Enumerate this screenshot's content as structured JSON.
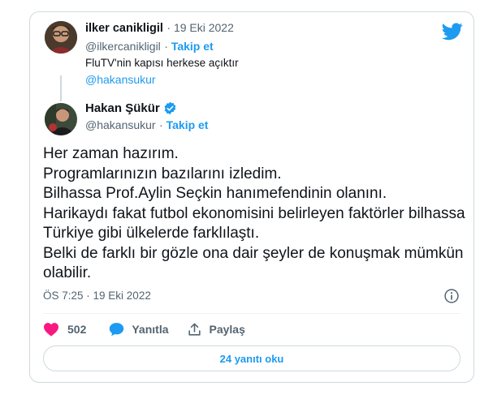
{
  "quoted": {
    "display_name": "ilker canikligil",
    "date": "19 Eki 2022",
    "handle": "@ilkercanikligil",
    "follow_label": "Takip et",
    "text": "FluTV'nin kapısı herkese açıktır",
    "mention": "@hakansukur"
  },
  "main": {
    "display_name": "Hakan Şükür",
    "handle": "@hakansukur",
    "follow_label": "Takip et",
    "body": "Her zaman hazırım.\nProgramlarınızın bazılarını izledim.\nBilhassa Prof.Aylin Seçkin hanımefendinin olanını.\nHarikaydı fakat futbol ekonomisini belirleyen faktörler bilhassa Türkiye gibi ülkelerde farklılaştı.\nBelki de farklı bir gözle ona dair şeyler de konuşmak mümkün olabilir.",
    "timestamp": "ÖS 7:25 · 19 Eki 2022"
  },
  "actions": {
    "likes": "502",
    "reply_label": "Yanıtla",
    "share_label": "Paylaş"
  },
  "footer": {
    "read_replies_label": "24 yanıtı oku"
  },
  "icons": {
    "brand": "twitter-bird-icon",
    "verified": "verified-badge-icon",
    "info": "info-icon",
    "like": "heart-icon",
    "reply": "speech-bubble-icon",
    "share": "share-icon"
  },
  "colors": {
    "brand": "#1d9bf0",
    "like": "#f91880",
    "text": "#0f1419",
    "muted": "#536471",
    "border": "#cfd9de"
  }
}
